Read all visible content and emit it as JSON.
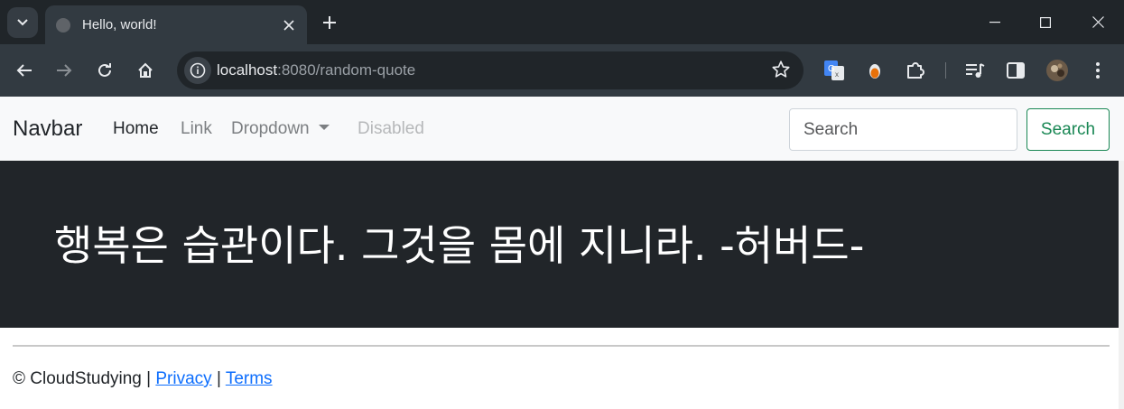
{
  "browser": {
    "tab_title": "Hello, world!",
    "url_host": "localhost",
    "url_rest": ":8080/random-quote",
    "icons": [
      "tab-search-icon",
      "close-icon",
      "plus-icon",
      "minimize-icon",
      "maximize-icon",
      "close-window-icon",
      "back-icon",
      "forward-icon",
      "reload-icon",
      "home-icon",
      "info-icon",
      "star-icon",
      "translate-icon",
      "extension-icon",
      "puzzle-icon",
      "media-icon",
      "sidepanel-icon",
      "avatar",
      "menu-icon"
    ]
  },
  "navbar": {
    "brand": "Navbar",
    "links": [
      "Home",
      "Link",
      "Dropdown",
      "Disabled"
    ],
    "search_placeholder": "Search",
    "search_button": "Search"
  },
  "hero": {
    "quote": "행복은 습관이다. 그것을 몸에 지니라. -허버드-"
  },
  "footer": {
    "copyright": "© CloudStudying |",
    "privacy": "Privacy",
    "separator": "|",
    "terms": "Terms"
  },
  "colors": {
    "hero_bg": "#212529",
    "navbar_bg": "#f8f9fa",
    "success": "#198754",
    "link": "#0d6efd"
  }
}
